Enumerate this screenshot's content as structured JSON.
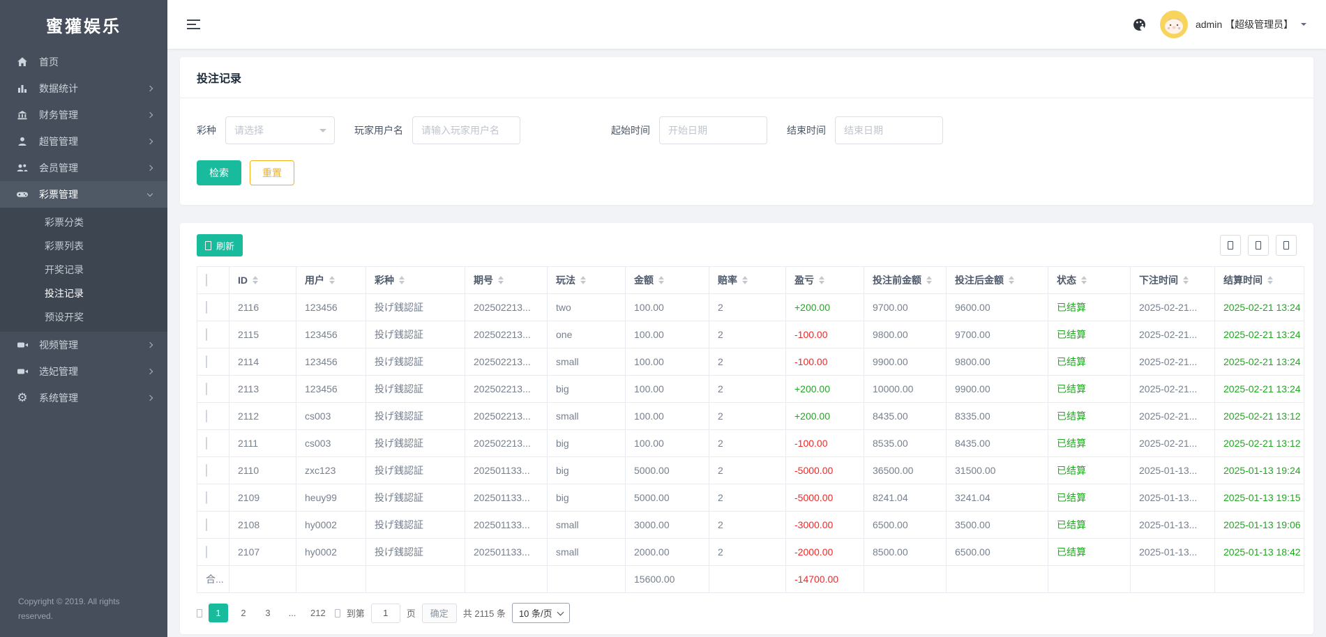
{
  "app": {
    "brand": "蜜獾娱乐",
    "user": "admin 【超级管理员】"
  },
  "colors": {
    "accent_teal": "#18bc9c",
    "warn_yellow": "#f5b014",
    "green": "#1fa81f",
    "red": "#f52626",
    "sidebar_bg": "#454e5a"
  },
  "sidebar": {
    "items": [
      {
        "label": "首页",
        "icon": "home-icon"
      },
      {
        "label": "数据统计",
        "icon": "bar-chart-icon",
        "chevron": "right"
      },
      {
        "label": "财务管理",
        "icon": "bank-icon",
        "chevron": "right"
      },
      {
        "label": "超管管理",
        "icon": "user-icon",
        "chevron": "right"
      },
      {
        "label": "会员管理",
        "icon": "users-icon",
        "chevron": "right"
      },
      {
        "label": "彩票管理",
        "icon": "gamepad-icon",
        "chevron": "down",
        "active": true,
        "children": [
          {
            "label": "彩票分类"
          },
          {
            "label": "彩票列表"
          },
          {
            "label": "开奖记录"
          },
          {
            "label": "投注记录",
            "active": true
          },
          {
            "label": "预设开奖"
          }
        ]
      },
      {
        "label": "视频管理",
        "icon": "video-icon",
        "chevron": "right"
      },
      {
        "label": "选妃管理",
        "icon": "video-icon",
        "chevron": "right"
      },
      {
        "label": "系统管理",
        "icon": "gear-icon",
        "chevron": "right"
      }
    ],
    "copyright": "Copyright © 2019. All rights reserved."
  },
  "filter": {
    "title": "投注记录",
    "lottery_label": "彩种",
    "lottery_placeholder": "请选择",
    "username_label": "玩家用户名",
    "username_placeholder": "请输入玩家用户名",
    "start_label": "起始时间",
    "start_placeholder": "开始日期",
    "end_label": "结束时间",
    "end_placeholder": "结束日期",
    "search_label": "检索",
    "reset_label": "重置"
  },
  "toolbar": {
    "refresh_label": "刷新"
  },
  "table": {
    "columns": [
      {
        "key": "sel",
        "label": "",
        "type": "checkbox"
      },
      {
        "key": "id",
        "label": "ID",
        "sortable": true
      },
      {
        "key": "user",
        "label": "用户",
        "sortable": true
      },
      {
        "key": "lottery",
        "label": "彩种",
        "sortable": true
      },
      {
        "key": "issue",
        "label": "期号",
        "sortable": true
      },
      {
        "key": "play",
        "label": "玩法",
        "sortable": true
      },
      {
        "key": "amount",
        "label": "金额",
        "sortable": true
      },
      {
        "key": "odds",
        "label": "赔率",
        "sortable": true
      },
      {
        "key": "profit",
        "label": "盈亏",
        "sortable": true,
        "color": "sign"
      },
      {
        "key": "before",
        "label": "投注前金额",
        "sortable": true
      },
      {
        "key": "after",
        "label": "投注后金额",
        "sortable": true
      },
      {
        "key": "status",
        "label": "状态",
        "sortable": true,
        "color": "green"
      },
      {
        "key": "bet_time",
        "label": "下注时间",
        "sortable": true
      },
      {
        "key": "settle_time",
        "label": "结算时间",
        "sortable": true,
        "color": "green"
      }
    ],
    "rows": [
      {
        "id": "2116",
        "user": "123456",
        "lottery": "投げ銭認証",
        "issue": "202502213...",
        "play": "two",
        "amount": "100.00",
        "odds": "2",
        "profit": "+200.00",
        "before": "9700.00",
        "after": "9600.00",
        "status": "已结算",
        "bet_time": "2025-02-21...",
        "settle_time": "2025-02-21 13:24"
      },
      {
        "id": "2115",
        "user": "123456",
        "lottery": "投げ銭認証",
        "issue": "202502213...",
        "play": "one",
        "amount": "100.00",
        "odds": "2",
        "profit": "-100.00",
        "before": "9800.00",
        "after": "9700.00",
        "status": "已结算",
        "bet_time": "2025-02-21...",
        "settle_time": "2025-02-21 13:24"
      },
      {
        "id": "2114",
        "user": "123456",
        "lottery": "投げ銭認証",
        "issue": "202502213...",
        "play": "small",
        "amount": "100.00",
        "odds": "2",
        "profit": "-100.00",
        "before": "9900.00",
        "after": "9800.00",
        "status": "已结算",
        "bet_time": "2025-02-21...",
        "settle_time": "2025-02-21 13:24"
      },
      {
        "id": "2113",
        "user": "123456",
        "lottery": "投げ銭認証",
        "issue": "202502213...",
        "play": "big",
        "amount": "100.00",
        "odds": "2",
        "profit": "+200.00",
        "before": "10000.00",
        "after": "9900.00",
        "status": "已结算",
        "bet_time": "2025-02-21...",
        "settle_time": "2025-02-21 13:24"
      },
      {
        "id": "2112",
        "user": "cs003",
        "lottery": "投げ銭認証",
        "issue": "202502213...",
        "play": "small",
        "amount": "100.00",
        "odds": "2",
        "profit": "+200.00",
        "before": "8435.00",
        "after": "8335.00",
        "status": "已结算",
        "bet_time": "2025-02-21...",
        "settle_time": "2025-02-21 13:12"
      },
      {
        "id": "2111",
        "user": "cs003",
        "lottery": "投げ銭認証",
        "issue": "202502213...",
        "play": "big",
        "amount": "100.00",
        "odds": "2",
        "profit": "-100.00",
        "before": "8535.00",
        "after": "8435.00",
        "status": "已结算",
        "bet_time": "2025-02-21...",
        "settle_time": "2025-02-21 13:12"
      },
      {
        "id": "2110",
        "user": "zxc123",
        "lottery": "投げ銭認証",
        "issue": "202501133...",
        "play": "big",
        "amount": "5000.00",
        "odds": "2",
        "profit": "-5000.00",
        "before": "36500.00",
        "after": "31500.00",
        "status": "已结算",
        "bet_time": "2025-01-13...",
        "settle_time": "2025-01-13 19:24"
      },
      {
        "id": "2109",
        "user": "heuy99",
        "lottery": "投げ銭認証",
        "issue": "202501133...",
        "play": "big",
        "amount": "5000.00",
        "odds": "2",
        "profit": "-5000.00",
        "before": "8241.04",
        "after": "3241.04",
        "status": "已结算",
        "bet_time": "2025-01-13...",
        "settle_time": "2025-01-13 19:15"
      },
      {
        "id": "2108",
        "user": "hy0002",
        "lottery": "投げ銭認証",
        "issue": "202501133...",
        "play": "small",
        "amount": "3000.00",
        "odds": "2",
        "profit": "-3000.00",
        "before": "6500.00",
        "after": "3500.00",
        "status": "已结算",
        "bet_time": "2025-01-13...",
        "settle_time": "2025-01-13 19:06"
      },
      {
        "id": "2107",
        "user": "hy0002",
        "lottery": "投げ銭認証",
        "issue": "202501133...",
        "play": "small",
        "amount": "2000.00",
        "odds": "2",
        "profit": "-2000.00",
        "before": "8500.00",
        "after": "6500.00",
        "status": "已结算",
        "bet_time": "2025-01-13...",
        "settle_time": "2025-01-13 18:42"
      }
    ],
    "summary": {
      "sel": "合...",
      "amount": "15600.00",
      "profit": "-14700.00"
    }
  },
  "pagination": {
    "pages": [
      "1",
      "2",
      "3",
      "...",
      "212"
    ],
    "active": "1",
    "goto_label": "到第",
    "goto_value": "1",
    "page_unit": "页",
    "confirm_label": "确定",
    "total_label": "共 2115 条",
    "page_size_label": "10 条/页"
  }
}
